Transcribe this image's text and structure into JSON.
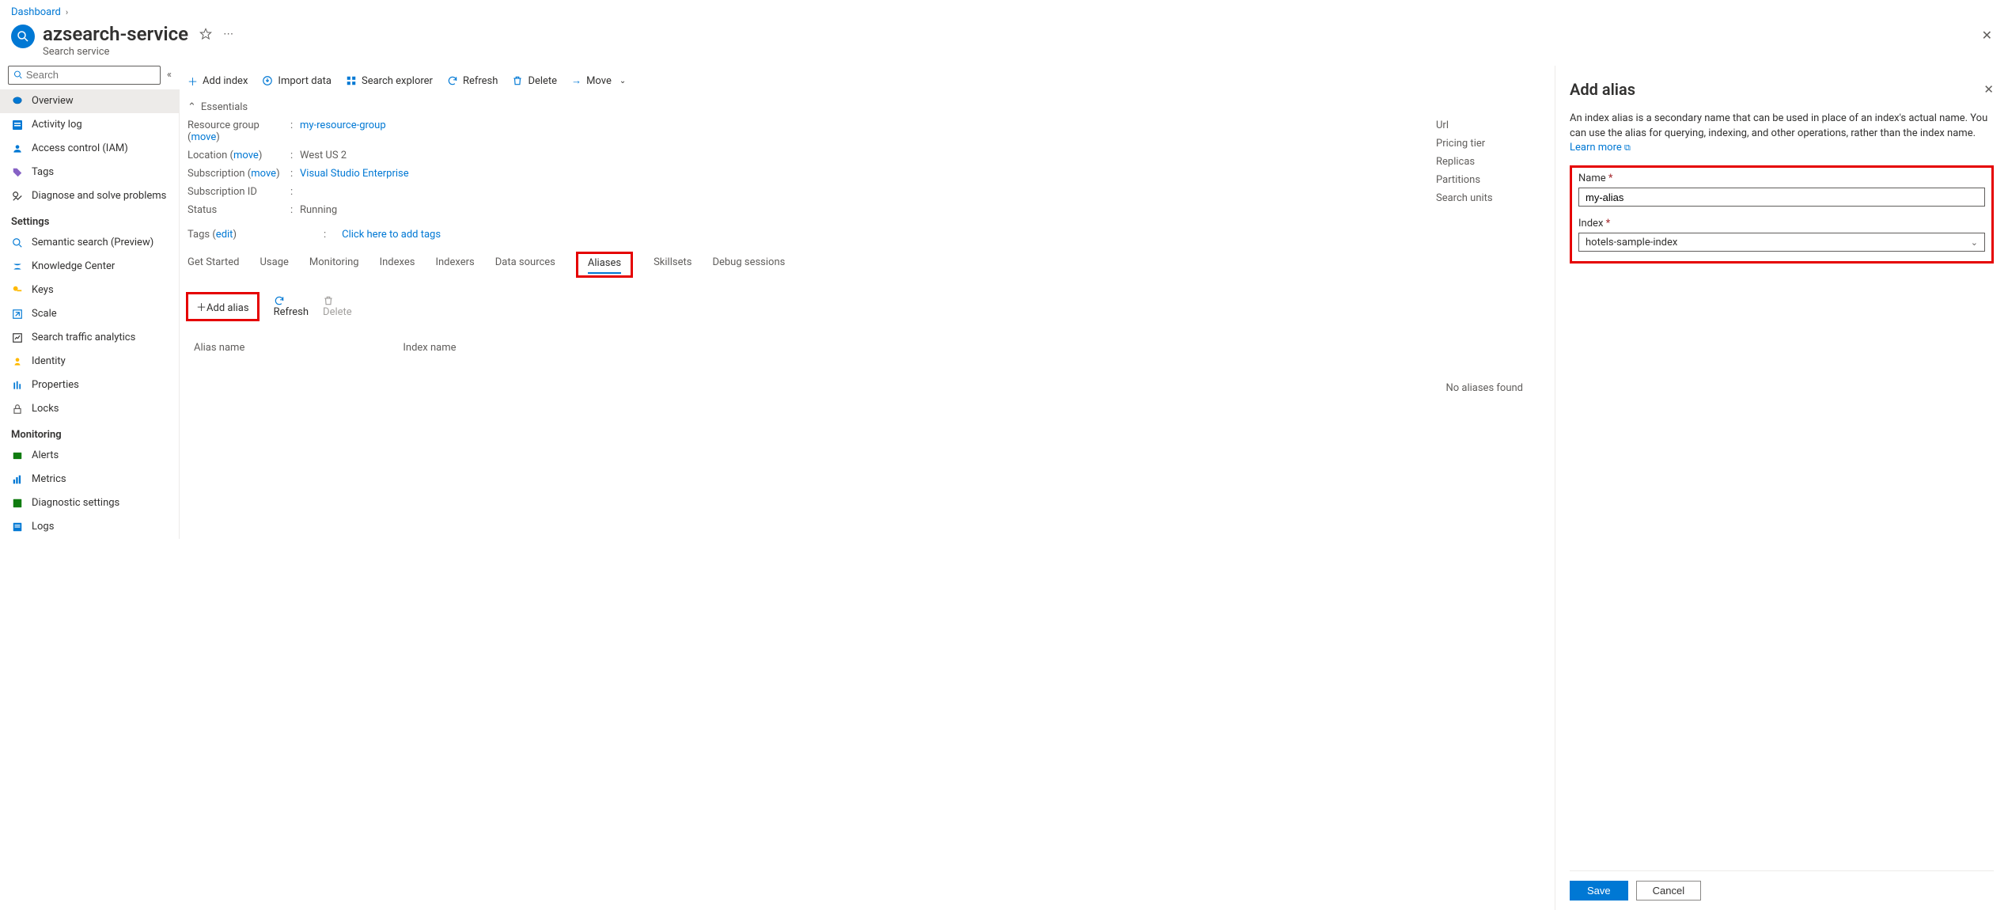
{
  "breadcrumb": {
    "root": "Dashboard"
  },
  "resource": {
    "title": "azsearch-service",
    "subtitle": "Search service"
  },
  "sidebar": {
    "search_placeholder": "Search",
    "items": [
      {
        "label": "Overview"
      },
      {
        "label": "Activity log"
      },
      {
        "label": "Access control (IAM)"
      },
      {
        "label": "Tags"
      },
      {
        "label": "Diagnose and solve problems"
      }
    ],
    "settings_header": "Settings",
    "settings": [
      {
        "label": "Semantic search (Preview)"
      },
      {
        "label": "Knowledge Center"
      },
      {
        "label": "Keys"
      },
      {
        "label": "Scale"
      },
      {
        "label": "Search traffic analytics"
      },
      {
        "label": "Identity"
      },
      {
        "label": "Properties"
      },
      {
        "label": "Locks"
      }
    ],
    "monitoring_header": "Monitoring",
    "monitoring": [
      {
        "label": "Alerts"
      },
      {
        "label": "Metrics"
      },
      {
        "label": "Diagnostic settings"
      },
      {
        "label": "Logs"
      }
    ]
  },
  "toolbar": {
    "add_index": "Add index",
    "import_data": "Import data",
    "search_explorer": "Search explorer",
    "refresh": "Refresh",
    "delete": "Delete",
    "move": "Move"
  },
  "essentials": {
    "toggle": "Essentials",
    "left": {
      "resource_group_label": "Resource group (",
      "resource_group_move": "move",
      "resource_group_close": ")",
      "resource_group_value": "my-resource-group",
      "location_label": "Location (",
      "location_move": "move",
      "location_close": ")",
      "location_value": "West US 2",
      "subscription_label": "Subscription (",
      "subscription_move": "move",
      "subscription_close": ")",
      "subscription_value": "Visual Studio Enterprise",
      "subscription_id_label": "Subscription ID",
      "subscription_id_value": "",
      "status_label": "Status",
      "status_value": "Running"
    },
    "right": {
      "url_label": "Url",
      "pricing_label": "Pricing tier",
      "replicas_label": "Replicas",
      "partitions_label": "Partitions",
      "search_units_label": "Search units"
    }
  },
  "tags": {
    "label": "Tags (",
    "edit": "edit",
    "close": ")",
    "placeholder": "Click here to add tags"
  },
  "tabs": {
    "get_started": "Get Started",
    "usage": "Usage",
    "monitoring": "Monitoring",
    "indexes": "Indexes",
    "indexers": "Indexers",
    "data_sources": "Data sources",
    "aliases": "Aliases",
    "skillsets": "Skillsets",
    "debug_sessions": "Debug sessions"
  },
  "subtoolbar": {
    "add_alias": "Add alias",
    "refresh": "Refresh",
    "delete": "Delete"
  },
  "alias_table": {
    "col_alias": "Alias name",
    "col_index": "Index name",
    "empty": "No aliases found"
  },
  "panel": {
    "title": "Add alias",
    "description": "An index alias is a secondary name that can be used in place of an index's actual name. You can use the alias for querying, indexing, and other operations, rather than the index name. ",
    "learn_more": "Learn more",
    "name_label": "Name",
    "name_value": "my-alias",
    "index_label": "Index",
    "index_value": "hotels-sample-index",
    "save": "Save",
    "cancel": "Cancel"
  }
}
